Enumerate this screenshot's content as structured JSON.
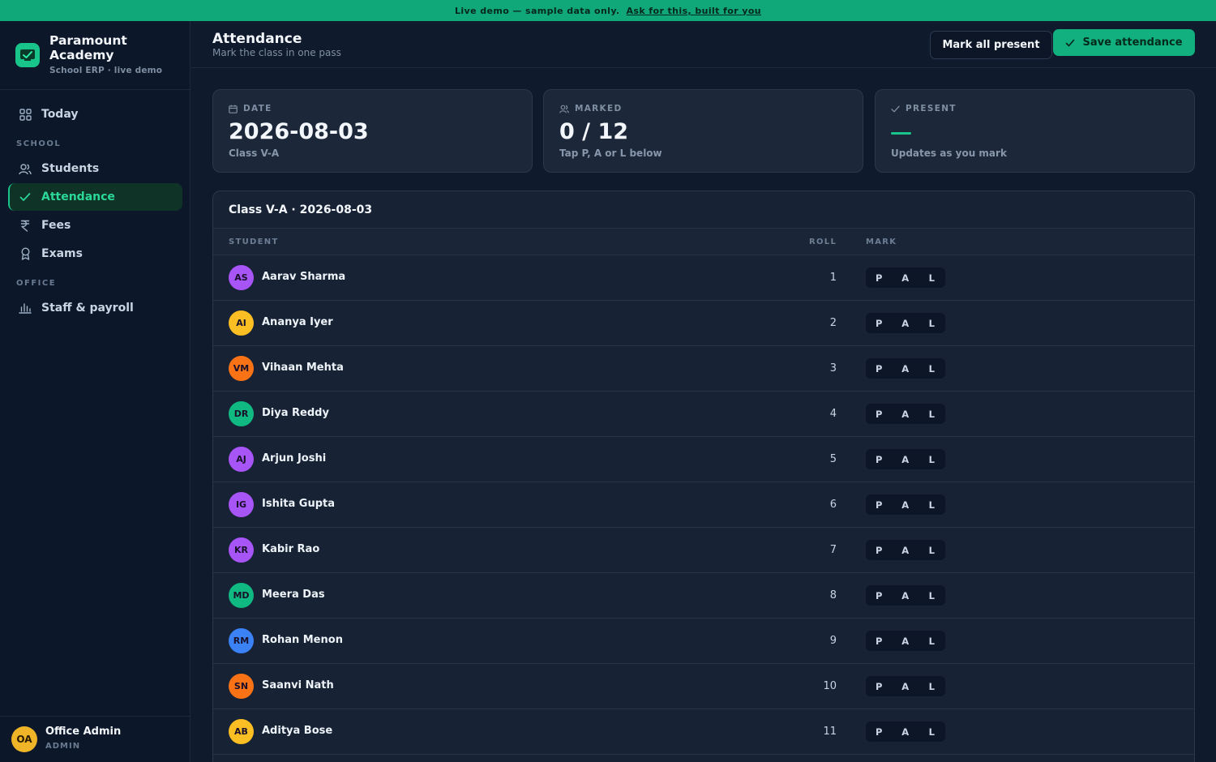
{
  "banner": {
    "text": "Live demo — sample data only.",
    "link": "Ask for this, built for you"
  },
  "brand": {
    "name": "Paramount Academy",
    "sub": "School ERP · live demo"
  },
  "sidebar": {
    "today": "Today",
    "section_school": "SCHOOL",
    "students": "Students",
    "attendance": "Attendance",
    "fees": "Fees",
    "exams": "Exams",
    "section_office": "OFFICE",
    "staff": "Staff & payroll"
  },
  "user": {
    "initials": "OA",
    "name": "Office Admin",
    "role": "ADMIN"
  },
  "header": {
    "title": "Attendance",
    "subtitle": "Mark the class in one pass",
    "mark_all": "Mark all present",
    "save": "Save attendance"
  },
  "cards": {
    "date": {
      "caption": "DATE",
      "value": "2026-08-03",
      "note": "Class V-A"
    },
    "marked": {
      "caption": "MARKED",
      "value": "0 / 12",
      "note": "Tap P, A or L below"
    },
    "present": {
      "caption": "PRESENT",
      "note": "Updates as you mark"
    }
  },
  "table": {
    "title": "Class V-A · 2026-08-03",
    "col_student": "STUDENT",
    "col_roll": "ROLL",
    "col_mark": "MARK",
    "mark_labels": [
      "P",
      "A",
      "L"
    ],
    "rows": [
      {
        "initials": "AS",
        "name": "Aarav Sharma",
        "roll": "1",
        "color": "#a855f7"
      },
      {
        "initials": "AI",
        "name": "Ananya Iyer",
        "roll": "2",
        "color": "#fbbf24"
      },
      {
        "initials": "VM",
        "name": "Vihaan Mehta",
        "roll": "3",
        "color": "#f97316"
      },
      {
        "initials": "DR",
        "name": "Diya Reddy",
        "roll": "4",
        "color": "#10b981"
      },
      {
        "initials": "AJ",
        "name": "Arjun Joshi",
        "roll": "5",
        "color": "#a855f7"
      },
      {
        "initials": "IG",
        "name": "Ishita Gupta",
        "roll": "6",
        "color": "#a855f7"
      },
      {
        "initials": "KR",
        "name": "Kabir Rao",
        "roll": "7",
        "color": "#a855f7"
      },
      {
        "initials": "MD",
        "name": "Meera Das",
        "roll": "8",
        "color": "#10b981"
      },
      {
        "initials": "RM",
        "name": "Rohan Menon",
        "roll": "9",
        "color": "#3b82f6"
      },
      {
        "initials": "SN",
        "name": "Saanvi Nath",
        "roll": "10",
        "color": "#f97316"
      },
      {
        "initials": "AB",
        "name": "Aditya Bose",
        "roll": "11",
        "color": "#fbbf24"
      },
      {
        "initials": "",
        "name": "",
        "roll": "",
        "color": "#a855f7"
      }
    ]
  },
  "colors": {
    "accent": "#19c48a",
    "banner": "#10a878",
    "background": "#0f1b2d"
  }
}
